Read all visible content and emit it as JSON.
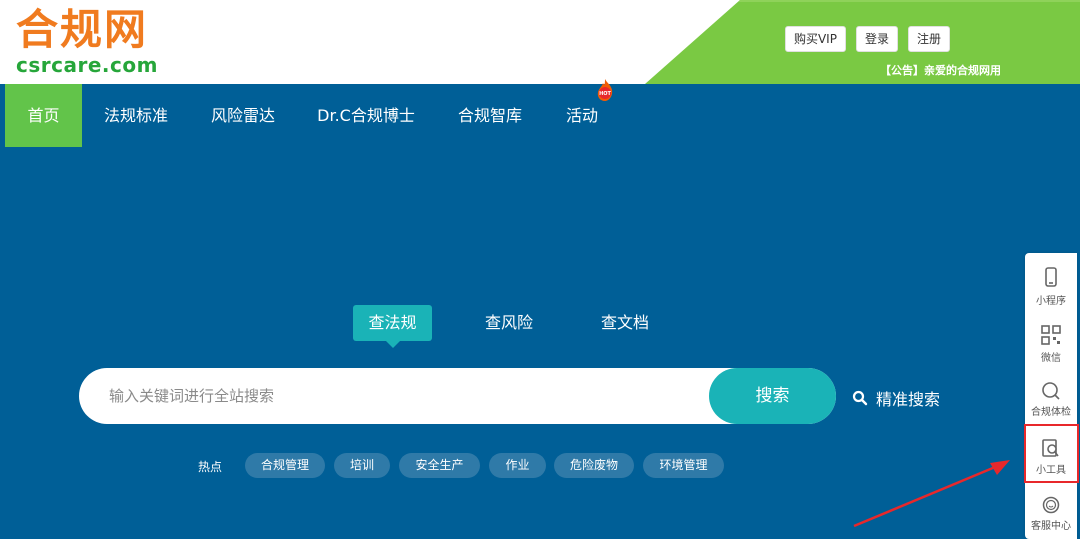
{
  "logo": {
    "cn": "合规网",
    "en": "csrcare.com"
  },
  "top_buttons": [
    "购买VIP",
    "登录",
    "注册"
  ],
  "notice": "【公告】亲爱的合规网用",
  "nav": {
    "items": [
      "首页",
      "法规标准",
      "风险雷达",
      "Dr.C合规博士",
      "合规智库",
      "活动"
    ],
    "active": "首页",
    "hot_badge": "HOT"
  },
  "search": {
    "tabs": [
      "查法规",
      "查风险",
      "查文档"
    ],
    "active_tab": "查法规",
    "placeholder": "输入关键词进行全站搜索",
    "button": "搜索",
    "precise": "精准搜索"
  },
  "hot": {
    "label": "热点",
    "tags": [
      "合规管理",
      "培训",
      "安全生产",
      "作业",
      "危险废物",
      "环境管理"
    ]
  },
  "sidebar": {
    "items": [
      {
        "label": "小程序",
        "icon": "phone-icon"
      },
      {
        "label": "微信",
        "icon": "qrcode-icon"
      },
      {
        "label": "合规体检",
        "icon": "search-icon"
      },
      {
        "label": "小工具",
        "icon": "tool-search-icon"
      },
      {
        "label": "客服中心",
        "icon": "service-icon"
      }
    ],
    "highlighted": "小工具"
  },
  "colors": {
    "nav_bg": "#005f97",
    "active_green": "#62c44a",
    "accent_teal": "#1ab3b7",
    "logo_orange": "#f07b1f",
    "logo_green": "#26a63a",
    "highlight_red": "#e8282b"
  }
}
